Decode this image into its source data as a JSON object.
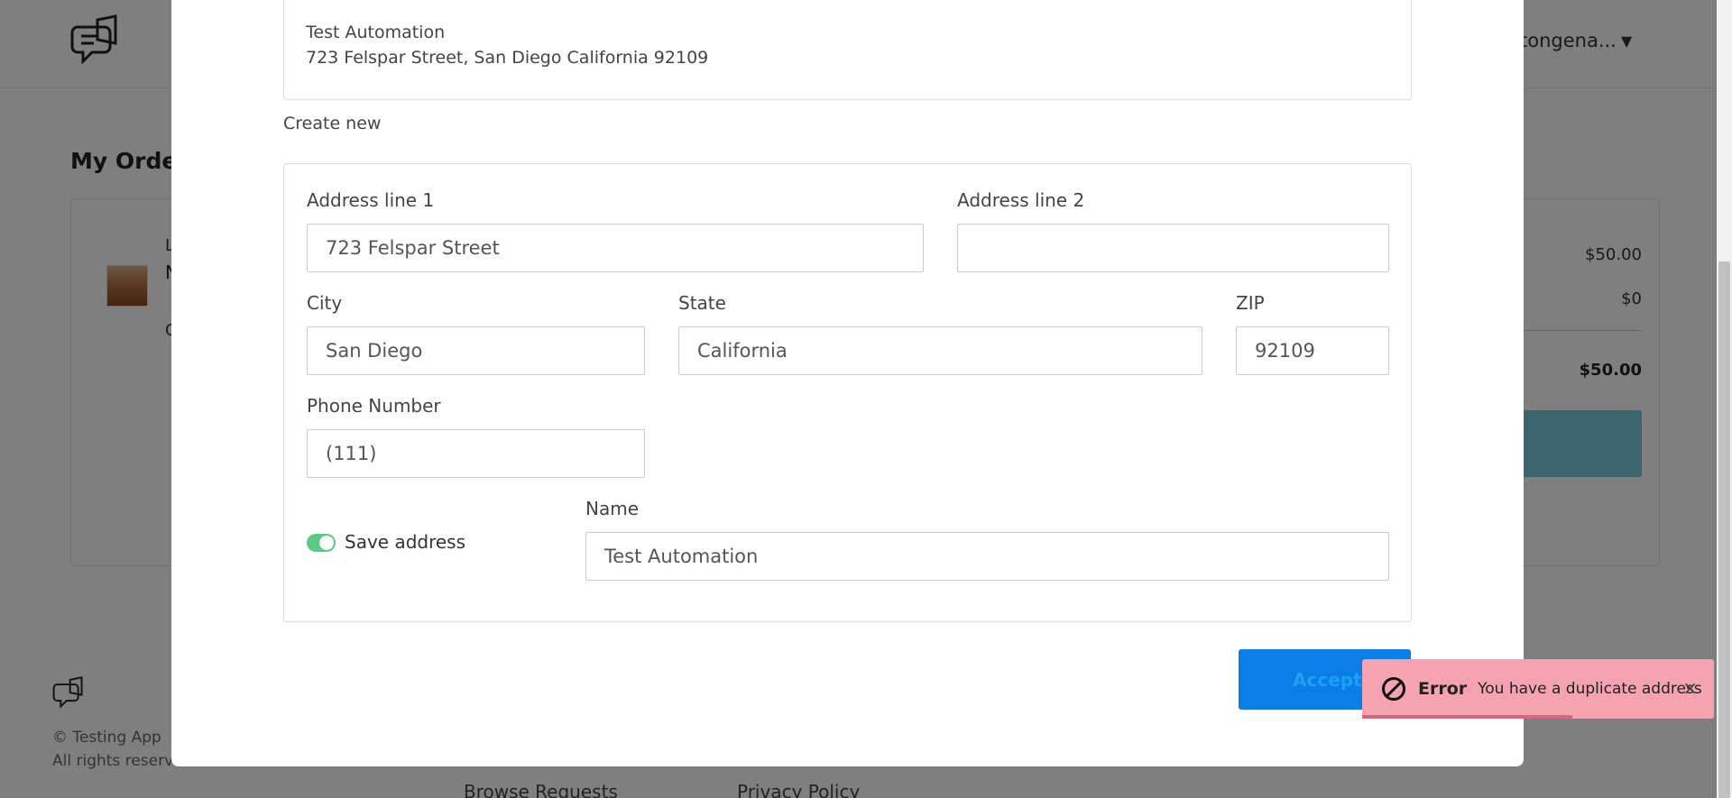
{
  "background": {
    "user_name": "tongena...",
    "page_title": "My Order",
    "order_item_letters": [
      "L",
      "N",
      "C"
    ],
    "summary": {
      "subtotal": "$50.00",
      "fee": "$0",
      "total": "$50.00"
    },
    "footer": {
      "copyright": "© Testing App",
      "rights": "All rights reserved",
      "links": [
        "Browse Requests",
        "Privacy Policy"
      ]
    }
  },
  "modal": {
    "existing_address": {
      "name": "Test Automation",
      "address": "723 Felspar Street, San Diego California 92109"
    },
    "create_new_label": "Create new",
    "form": {
      "address_line1": {
        "label": "Address line 1",
        "value": "723 Felspar Street"
      },
      "address_line2": {
        "label": "Address line 2",
        "value": ""
      },
      "city": {
        "label": "City",
        "value": "San Diego"
      },
      "state": {
        "label": "State",
        "value": "California"
      },
      "zip": {
        "label": "ZIP",
        "value": "92109"
      },
      "phone": {
        "label": "Phone Number",
        "value": "(111)"
      },
      "name": {
        "label": "Name",
        "value": "Test Automation"
      },
      "save_address": {
        "label": "Save address",
        "checked": true
      }
    },
    "accept_label": "Accept"
  },
  "toast": {
    "title": "Error",
    "message": "You have a duplicate address",
    "close": "×"
  },
  "colors": {
    "primary_button": "#0a7de6",
    "toggle_on": "#5cc88a",
    "toast_error_bg": "#f5a3b1"
  }
}
